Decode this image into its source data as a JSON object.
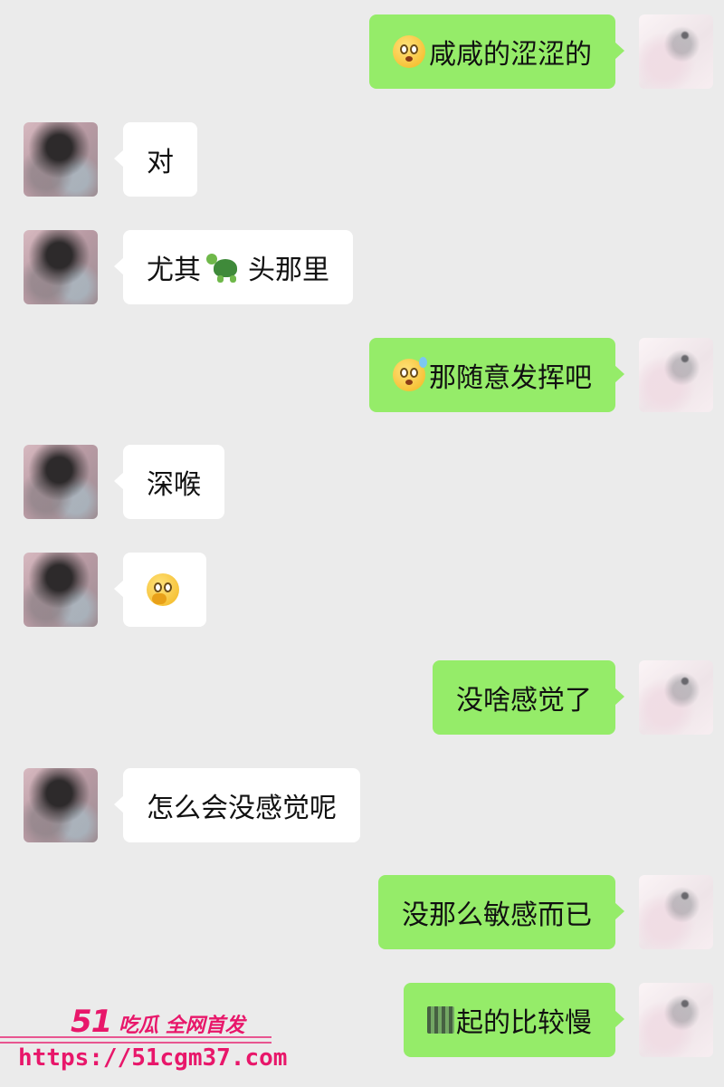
{
  "conversation": {
    "messages": [
      {
        "side": "right",
        "emoji": "flushed-face",
        "text": "咸咸的涩涩的"
      },
      {
        "side": "left",
        "text": "对"
      },
      {
        "side": "left",
        "text_before": "尤其",
        "emoji": "turtle",
        "text_after": "头那里"
      },
      {
        "side": "right",
        "emoji": "sweat-face",
        "text": "那随意发挥吧"
      },
      {
        "side": "left",
        "text": "深喉"
      },
      {
        "side": "left",
        "emoji": "face-with-hand-over-mouth",
        "text": ""
      },
      {
        "side": "right",
        "text": "没啥感觉了"
      },
      {
        "side": "left",
        "text": "怎么会没感觉呢"
      },
      {
        "side": "right",
        "text": "没那么敏感而已"
      },
      {
        "side": "right",
        "obscured_prefix": "blurred-character",
        "text": "起的比较慢"
      }
    ]
  },
  "watermark": {
    "brand_number": "51",
    "brand_text": "吃瓜 全网首发",
    "url": "https://51cgm37.com",
    "color": "#e8176a"
  },
  "colors": {
    "background": "#ebebeb",
    "outgoing_bubble": "#95ec69",
    "incoming_bubble": "#ffffff"
  }
}
